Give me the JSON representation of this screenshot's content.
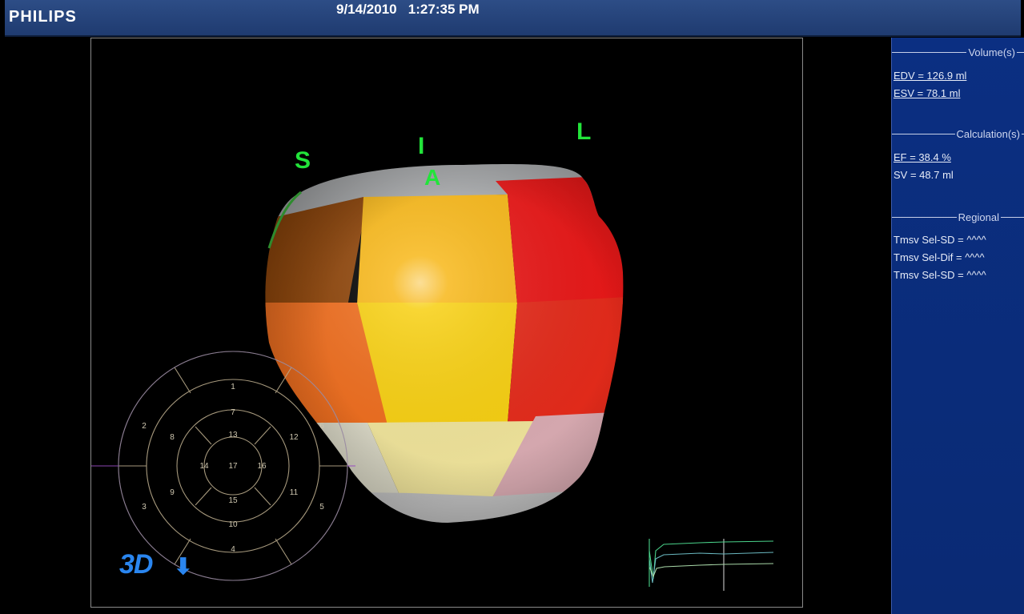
{
  "header": {
    "logo": "PHILIPS",
    "datetime": "9/14/2010   1:27:35 PM"
  },
  "viewport": {
    "orientation_labels": {
      "s": "S",
      "i": "I",
      "l": "L",
      "a": "A"
    },
    "badge": {
      "text": "3D",
      "arrow": "⬇"
    },
    "segment_colors": {
      "cap": "#a9abad",
      "seg_septal_basal": "#8c4206",
      "seg_inferior_basal": "#f7b718",
      "seg_lateral_basal": "#e81717",
      "seg_septal_mid": "#ee6c1c",
      "seg_inferior_mid": "#f7cf10",
      "seg_lateral_mid": "#e42a1a",
      "seg_apical_left": "#d9d7c5",
      "seg_apical_center": "#efe39a",
      "seg_apical_right": "#d8aab1",
      "apex": "#c2c2c2"
    },
    "bullseye": {
      "segments": [
        "1",
        "2",
        "3",
        "4",
        "5",
        "6",
        "7",
        "8",
        "9",
        "10",
        "11",
        "12",
        "13",
        "14",
        "15",
        "16",
        "17"
      ]
    }
  },
  "sidepanel": {
    "volumes": {
      "header": "Volume(s)",
      "edv": "EDV = 126.9 ml",
      "esv": "ESV = 78.1 ml"
    },
    "calculations": {
      "header": "Calculation(s)",
      "ef": "EF = 38.4 %",
      "sv": "SV = 48.7 ml"
    },
    "regional": {
      "header": "Regional",
      "items": [
        "Tmsv Sel-SD = ^^^^",
        "Tmsv Sel-Dif = ^^^^",
        "Tmsv Sel-SD = ^^^^"
      ]
    }
  }
}
